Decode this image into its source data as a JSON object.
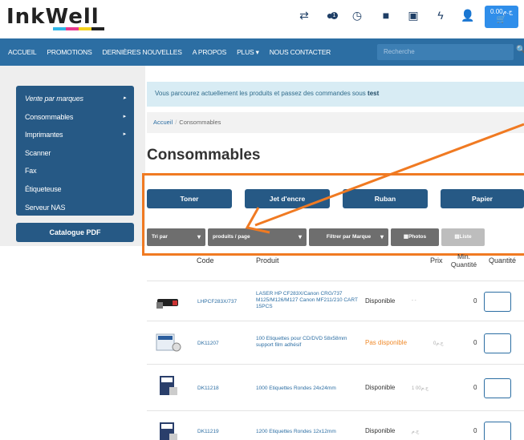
{
  "header": {
    "logo": "InkWell",
    "cart_amount": "0.00ج.م",
    "badge_count": "1",
    "icons": [
      "swap-icon",
      "badge-icon",
      "history-icon",
      "folder-icon",
      "monitor-icon",
      "bolt-icon",
      "user-icon"
    ]
  },
  "nav": {
    "items": [
      "ACCUEIL",
      "PROMOTIONS",
      "DERNIÈRES NOUVELLES",
      "A PROPOS",
      "PLUS ▾",
      "NOUS CONTACTER"
    ],
    "search_placeholder": "Recherche"
  },
  "sidebar": {
    "items": [
      {
        "label": "Vente par marques",
        "arrow": "▸"
      },
      {
        "label": "Consommables",
        "arrow": "▸"
      },
      {
        "label": "Imprimantes",
        "arrow": "▸"
      },
      {
        "label": "Scanner",
        "arrow": ""
      },
      {
        "label": "Fax",
        "arrow": ""
      },
      {
        "label": "Étiqueteuse",
        "arrow": ""
      },
      {
        "label": "Serveur NAS",
        "arrow": ""
      }
    ],
    "catalogue": "Catalogue PDF"
  },
  "alert": {
    "text": "Vous parcourez actuellement les produits et passez des commandes sous",
    "user": "test"
  },
  "breadcrumb": {
    "home": "Accueil",
    "sep": "/",
    "current": "Consommables"
  },
  "page_title": "Consommables",
  "categories": [
    "Toner",
    "Jet d'encre",
    "Ruban",
    "Papier"
  ],
  "filters": {
    "sort": "Tri par",
    "per_page": "produits / page",
    "brand": "Filtrer par Marque",
    "photos": "Photos",
    "list": "Liste"
  },
  "table": {
    "headers": {
      "code": "Code",
      "product": "Produit",
      "price": "Prix",
      "min": "Min. Quantité",
      "qty": "Quantité"
    },
    "rows": [
      {
        "code": "LHPCF283X/737",
        "name": "LASER HP CF283X/Canon CRG/737 M125/M126/M127 Canon MF211/210 CART 15PCS",
        "status": "Disponible",
        "available": true,
        "price": "- -",
        "min": "0"
      },
      {
        "code": "DK11207",
        "name": "100 Etiquettes pour CD/DVD 58x58mm support film adhésif",
        "status": "Pas disponible",
        "available": false,
        "price": "0ج.م",
        "min": "0"
      },
      {
        "code": "DK11218",
        "name": "1000 Etiquettes Rondes 24x24mm",
        "status": "Disponible",
        "available": true,
        "price": "1   00ج.م",
        "min": "0"
      },
      {
        "code": "DK11219",
        "name": "1200 Etiquettes Rondes 12x12mm",
        "status": "Disponible",
        "available": true,
        "price": "ج.م",
        "min": "0"
      }
    ]
  },
  "colors": {
    "brand": "#265985",
    "nav": "#2c6ea3",
    "accent": "#2f8eea",
    "annotation": "#f07a22",
    "warning": "#f08a2a"
  }
}
